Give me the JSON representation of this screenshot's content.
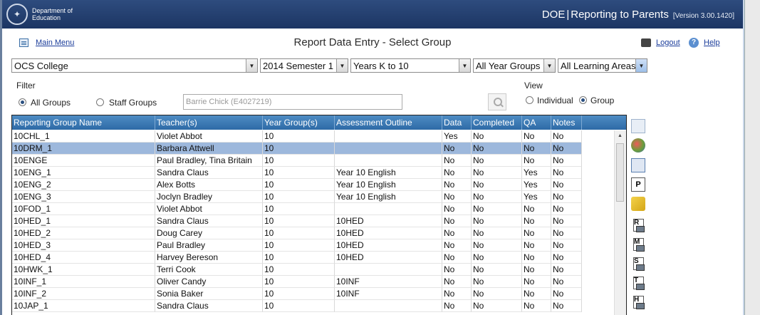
{
  "header": {
    "brand_line1": "Department of",
    "brand_line2": "Education",
    "app_prefix": "DOE",
    "app_sep": "|",
    "app_title": "Reporting to Parents",
    "version": "[Version 3.00.1420]"
  },
  "topbar": {
    "main_menu": "Main Menu",
    "page_title": "Report Data Entry - Select Group",
    "logout": "Logout",
    "help": "Help",
    "help_glyph": "?"
  },
  "selectors": {
    "school": "OCS College",
    "semester": "2014 Semester 1",
    "years": "Years K to 10",
    "year_groups": "All Year Groups",
    "learning_areas": "All Learning Areas"
  },
  "filter": {
    "label": "Filter",
    "all_groups": "All Groups",
    "staff_groups": "Staff Groups",
    "staff_value": "Barrie Chick (E4027219)",
    "selected": "all_groups"
  },
  "view": {
    "label": "View",
    "individual": "Individual",
    "group": "Group",
    "selected": "group"
  },
  "grid": {
    "columns": [
      "Reporting Group Name",
      "Teacher(s)",
      "Year Group(s)",
      "Assessment Outline",
      "Data",
      "Completed",
      "QA",
      "Notes"
    ],
    "selected_index": 1,
    "rows": [
      [
        "10CHL_1",
        "Violet Abbot",
        "10",
        "",
        "Yes",
        "No",
        "No",
        "No"
      ],
      [
        "10DRM_1",
        "Barbara Attwell",
        "10",
        "",
        "No",
        "No",
        "No",
        "No"
      ],
      [
        "10ENGE",
        "Paul Bradley, Tina Britain",
        "10",
        "",
        "No",
        "No",
        "No",
        "No"
      ],
      [
        "10ENG_1",
        "Sandra Claus",
        "10",
        "Year 10 English",
        "No",
        "No",
        "Yes",
        "No"
      ],
      [
        "10ENG_2",
        "Alex Botts",
        "10",
        "Year 10 English",
        "No",
        "No",
        "Yes",
        "No"
      ],
      [
        "10ENG_3",
        "Joclyn Bradley",
        "10",
        "Year 10 English",
        "No",
        "No",
        "Yes",
        "No"
      ],
      [
        "10FOD_1",
        "Violet Abbot",
        "10",
        "",
        "No",
        "No",
        "No",
        "No"
      ],
      [
        "10HED_1",
        "Sandra Claus",
        "10",
        "10HED",
        "No",
        "No",
        "No",
        "No"
      ],
      [
        "10HED_2",
        "Doug Carey",
        "10",
        "10HED",
        "No",
        "No",
        "No",
        "No"
      ],
      [
        "10HED_3",
        "Paul Bradley",
        "10",
        "10HED",
        "No",
        "No",
        "No",
        "No"
      ],
      [
        "10HED_4",
        "Harvey Bereson",
        "10",
        "10HED",
        "No",
        "No",
        "No",
        "No"
      ],
      [
        "10HWK_1",
        "Terri Cook",
        "10",
        "",
        "No",
        "No",
        "No",
        "No"
      ],
      [
        "10INF_1",
        "Oliver Candy",
        "10",
        "10INF",
        "No",
        "No",
        "No",
        "No"
      ],
      [
        "10INF_2",
        "Sonia Baker",
        "10",
        "10INF",
        "No",
        "No",
        "No",
        "No"
      ],
      [
        "10JAP_1",
        "Sandra Claus",
        "10",
        "",
        "No",
        "No",
        "No",
        "No"
      ]
    ]
  },
  "side_tools": {
    "letters": [
      "R",
      "M",
      "S",
      "T",
      "H"
    ]
  },
  "colors": {
    "header_bg": "#1f3a6b",
    "grid_header": "#3a78b4",
    "selected_row": "#9db8dc"
  }
}
